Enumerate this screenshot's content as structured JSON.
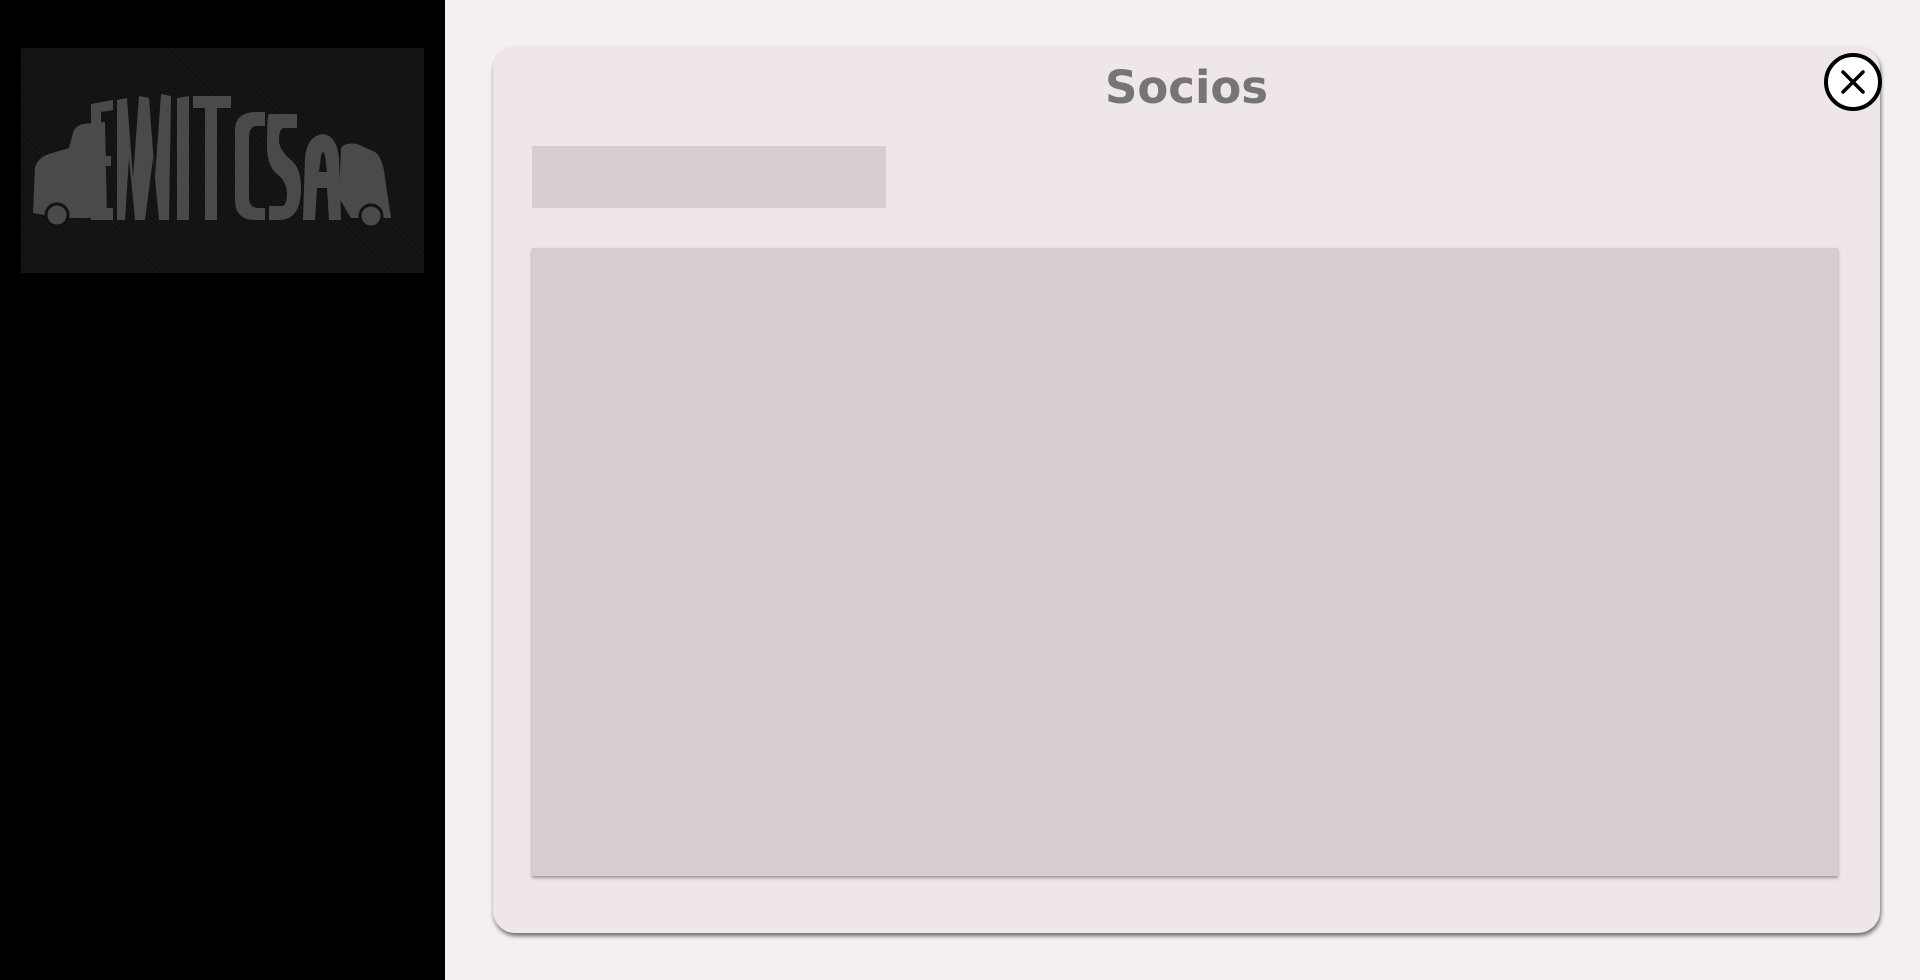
{
  "brand": {
    "logo_text": "EMITCSA",
    "logo_icon": "bus-logo"
  },
  "dialog": {
    "title": "Socios",
    "close_icon": "close-icon"
  },
  "search": {
    "value": "",
    "placeholder": ""
  },
  "list": {
    "rows": []
  },
  "colors": {
    "sidebar": "#000000",
    "logo_bg": "#121212",
    "logo_fg": "#4a4a4a",
    "page_bg": "#f5f0f0",
    "dialog_bg": "#efe6e7",
    "panel_bg": "#d7cdcf",
    "title": "#757575"
  }
}
